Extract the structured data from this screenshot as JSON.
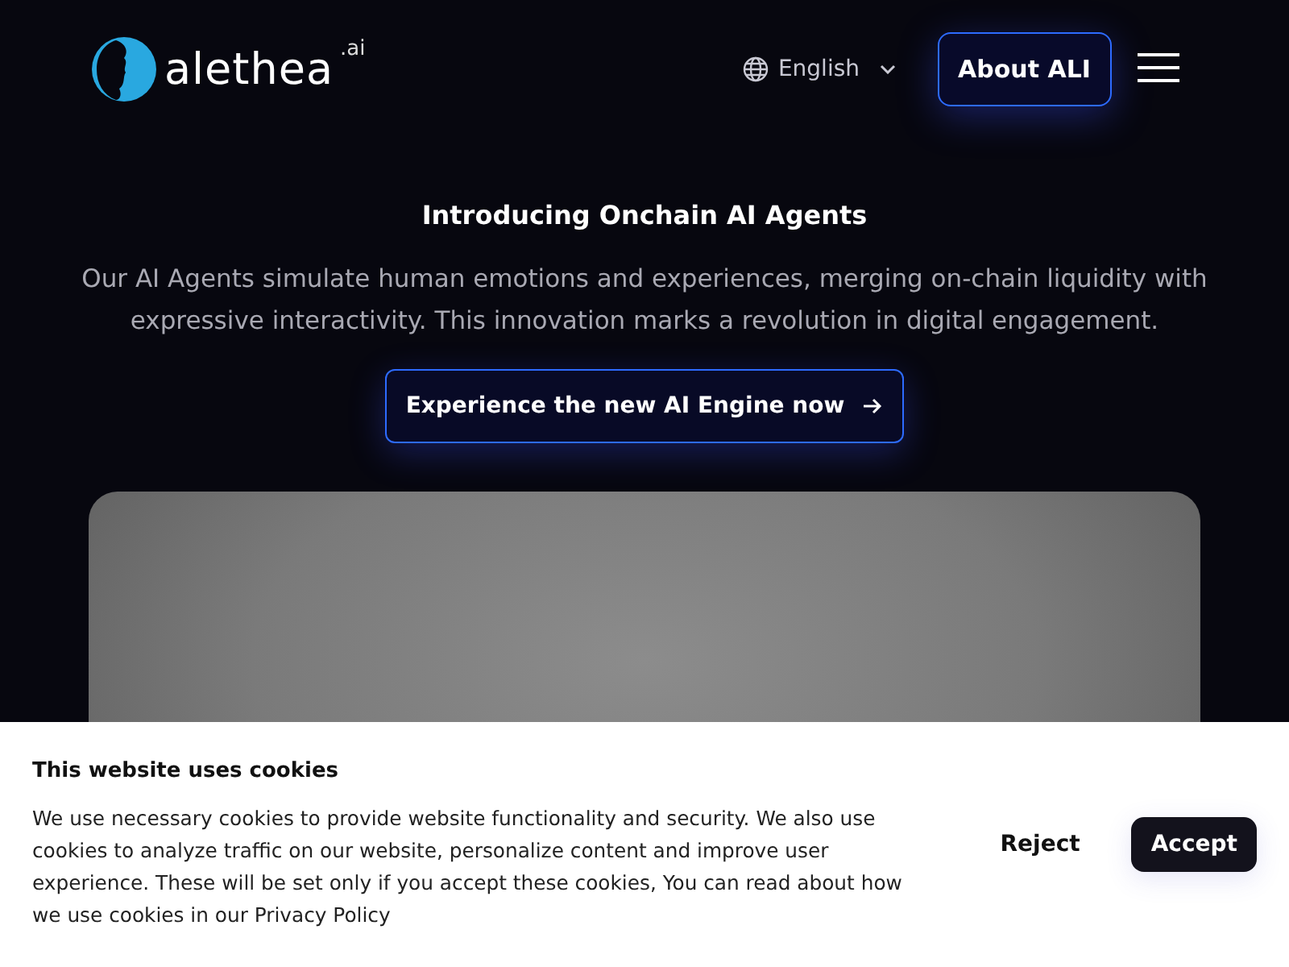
{
  "header": {
    "logo": {
      "name": "alethea",
      "suffix": ".ai"
    },
    "language": "English",
    "about_button": "About ALI"
  },
  "hero": {
    "title": "Introducing Onchain AI Agents",
    "description": "Our AI Agents simulate human emotions and experiences, merging on-chain liquidity with expressive interactivity. This innovation marks a revolution in digital engagement.",
    "cta": "Experience the new AI Engine now"
  },
  "cookie_banner": {
    "title": "This website uses cookies",
    "text": "We use necessary cookies to provide website functionality and security. We also use cookies to analyze traffic on our website, personalize content and improve user experience. These will be set only if you accept these cookies, You can read about how we use cookies in our Privacy Policy",
    "buttons": [
      {
        "label": "Reject",
        "kind": "text"
      },
      {
        "label": "Accept",
        "kind": "filled"
      }
    ]
  }
}
